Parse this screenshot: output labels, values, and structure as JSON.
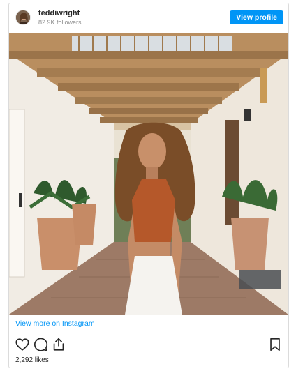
{
  "header": {
    "username": "teddiwright",
    "followers": "82.9K followers",
    "view_profile_label": "View profile"
  },
  "post": {
    "view_more_label": "View more on Instagram",
    "likes": "2,292 likes"
  },
  "icons": {
    "like": "heart-icon",
    "comment": "comment-icon",
    "share": "share-icon",
    "save": "bookmark-icon"
  },
  "colors": {
    "accent": "#0095f6",
    "text": "#262626",
    "muted": "#8e8e8e"
  }
}
